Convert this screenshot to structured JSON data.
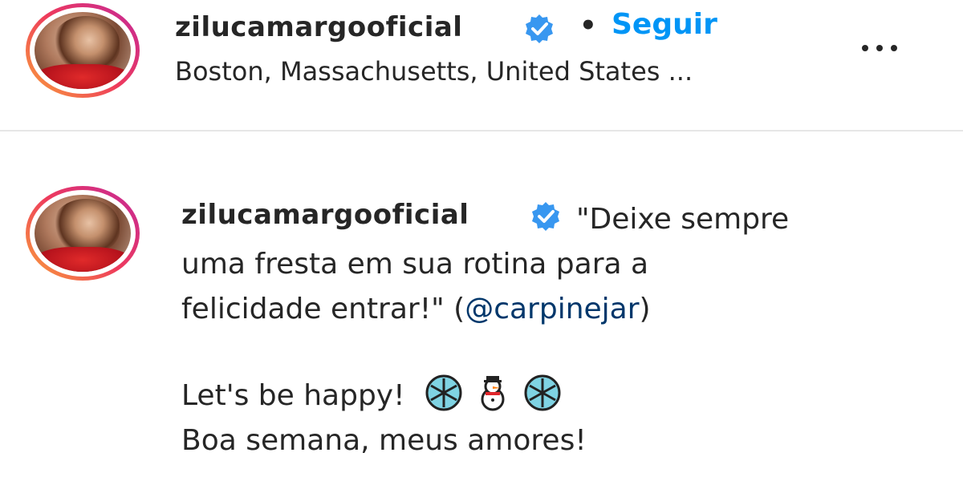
{
  "header": {
    "username": "zilucamargooficial",
    "verified_icon": "verified-badge-icon",
    "separator": "•",
    "follow_label": "Seguir",
    "location": "Boston, Massachusetts, United States ...",
    "more_icon": "more-options-icon"
  },
  "caption": {
    "username": "zilucamargooficial",
    "quote_line1": "\"Deixe sempre",
    "quote_line2": "uma fresta em sua rotina para a",
    "quote_line3_pre": "felicidade entrar!\" (",
    "mention": "@carpinejar",
    "quote_line3_post": ")",
    "line4": "Let's be happy!",
    "line4_emojis": [
      "snowflake-icon",
      "snowman-icon",
      "snowflake-icon"
    ],
    "line5": "Boa semana, meus amores!"
  },
  "colors": {
    "accent": "#0095f6",
    "verified": "#3897f0",
    "mention": "#00376b",
    "text": "#262626",
    "divider": "#e6e6e6"
  }
}
